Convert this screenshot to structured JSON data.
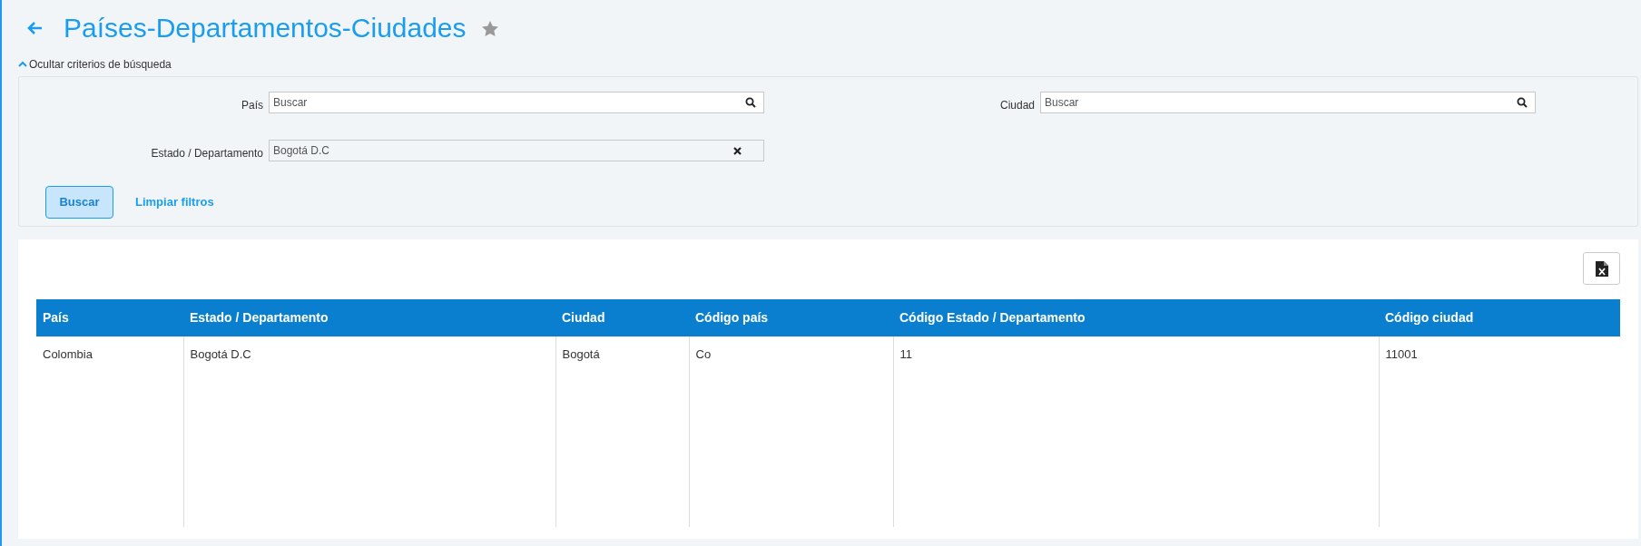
{
  "header": {
    "title": "Países-Departamentos-Ciudades",
    "favorite": false
  },
  "filter_toggle": {
    "label": "Ocultar criterios de búsqueda",
    "expanded": true
  },
  "filters": [
    {
      "kind": "search",
      "label": "País",
      "placeholder": "Buscar"
    },
    {
      "kind": "search",
      "label": "Ciudad",
      "placeholder": "Buscar"
    },
    {
      "kind": "selected",
      "label": "Estado / Departamento",
      "value": "Bogotá D.C"
    }
  ],
  "actions": {
    "search": "Buscar",
    "clear": "Limpiar filtros"
  },
  "table": {
    "columns": [
      "País",
      "Estado / Departamento",
      "Ciudad",
      "Código país",
      "Código Estado / Departamento",
      "Código ciudad"
    ],
    "rows": [
      [
        "Colombia",
        "Bogotá D.C",
        "Bogotá",
        "Co",
        "11",
        "11001"
      ]
    ]
  }
}
